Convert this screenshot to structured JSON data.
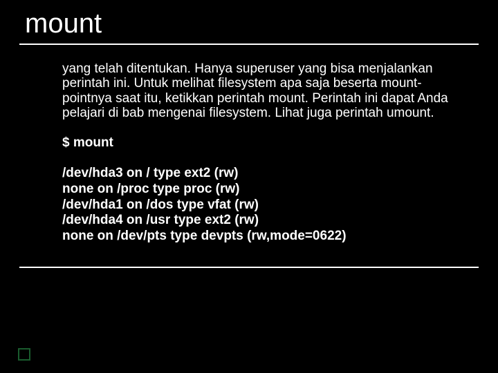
{
  "title": "mount",
  "description": "yang telah ditentukan. Hanya superuser yang bisa menjalankan perintah ini. Untuk melihat filesystem apa saja beserta mount-pointnya saat itu, ketikkan perintah mount. Perintah ini dapat Anda pelajari di bab mengenai filesystem. Lihat juga perintah umount.",
  "command": "$ mount",
  "output": [
    "/dev/hda3 on / type ext2 (rw)",
    "none on /proc type proc (rw)",
    "/dev/hda1 on /dos type vfat (rw)",
    "/dev/hda4 on /usr type ext2 (rw)",
    "none on /dev/pts type devpts (rw,mode=0622)"
  ]
}
